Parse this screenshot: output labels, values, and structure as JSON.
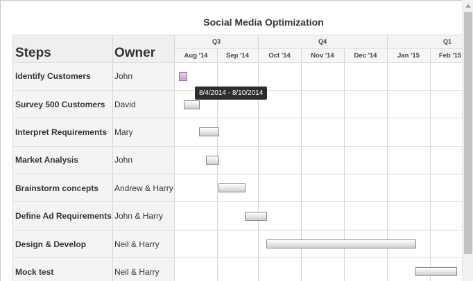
{
  "title": "Social Media Optimization",
  "headers": {
    "steps": "Steps",
    "owner": "Owner"
  },
  "quarters": [
    "Q3",
    "Q4",
    "Q1"
  ],
  "months": [
    "Aug '14",
    "Sep '14",
    "Oct '14",
    "Nov '14",
    "Dec '14",
    "Jan '15",
    "Feb '15"
  ],
  "tasks": [
    {
      "step": "Identify Customers",
      "owner": "John"
    },
    {
      "step": "Survey 500 Customers",
      "owner": "David"
    },
    {
      "step": "Interpret Requirements",
      "owner": "Mary"
    },
    {
      "step": "Market Analysis",
      "owner": "John"
    },
    {
      "step": "Brainstorm concepts",
      "owner": "Andrew & Harry"
    },
    {
      "step": "Define Ad Requirements",
      "owner": "John & Harry"
    },
    {
      "step": "Design & Develop",
      "owner": "Neil & Harry"
    },
    {
      "step": "Mock test",
      "owner": "Neil & Harry"
    }
  ],
  "tooltip": "8/4/2014 - 8/10/2014",
  "colors": {
    "bar": "#cfcfcf",
    "selected_bar": "#c9a4c9",
    "tooltip_bg": "#2d2d2d"
  },
  "icons": {
    "scroll_up": "triangle-up-icon"
  }
}
